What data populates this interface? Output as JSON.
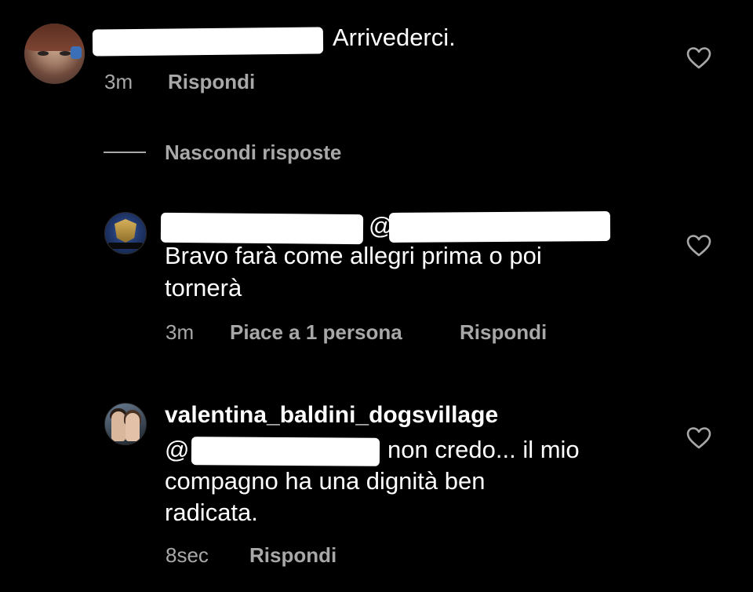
{
  "comments": [
    {
      "text": "Arrivederci.",
      "time": "3m",
      "reply_label": "Rispondi",
      "like_icon": "heart-outline-icon"
    }
  ],
  "replies_toggle": {
    "label": "Nascondi risposte"
  },
  "replies": [
    {
      "mention_symbol": "@",
      "text_line1": "Bravo farà come allegri prima o poi",
      "text_line2": "tornerà",
      "time": "3m",
      "likes_label": "Piace a 1 persona",
      "reply_label": "Rispondi",
      "like_icon": "heart-outline-icon"
    },
    {
      "username": "valentina_baldini_dogsvillage",
      "mention_symbol": "@",
      "text_line1": "non credo... il mio",
      "text_line2": "compagno ha una dignità ben",
      "text_line3": "radicata.",
      "time": "8sec",
      "reply_label": "Rispondi",
      "like_icon": "heart-outline-icon"
    }
  ],
  "colors": {
    "background": "#000000",
    "text_primary": "#ffffff",
    "text_secondary": "#a8a8a8"
  }
}
